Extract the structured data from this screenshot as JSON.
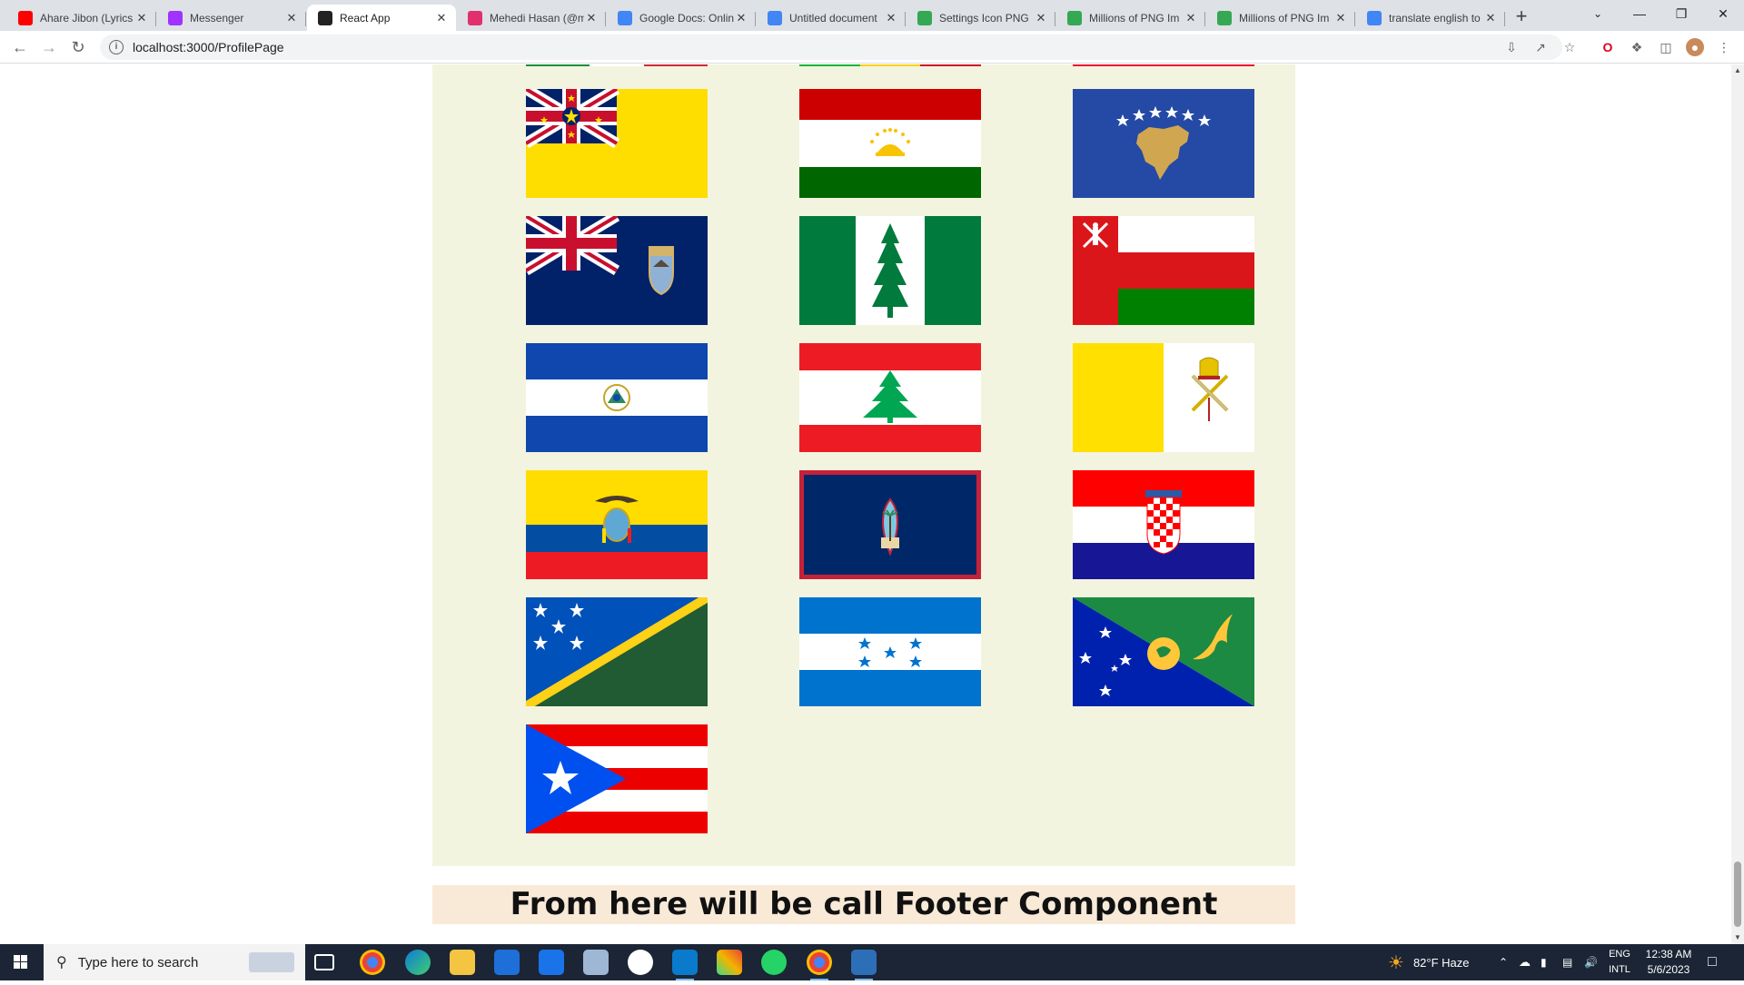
{
  "browser": {
    "tabs": [
      {
        "title": "Ahare Jibon (Lyrics",
        "favicon": "youtube-icon",
        "color": "#ff0000",
        "active": false
      },
      {
        "title": "Messenger",
        "favicon": "messenger-icon",
        "color": "#a033ff",
        "active": false
      },
      {
        "title": "React App",
        "favicon": "react-icon",
        "color": "#222222",
        "active": true
      },
      {
        "title": "Mehedi Hasan (@m",
        "favicon": "instagram-icon",
        "color": "#e1306c",
        "active": false
      },
      {
        "title": "Google Docs: Onlin",
        "favicon": "google-docs-icon",
        "color": "#4285f4",
        "active": false
      },
      {
        "title": "Untitled document",
        "favicon": "google-docs-icon",
        "color": "#4285f4",
        "active": false
      },
      {
        "title": "Settings Icon PNG",
        "favicon": "pngtree-icon",
        "color": "#34a853",
        "active": false
      },
      {
        "title": "Millions of PNG Im",
        "favicon": "pngtree-icon",
        "color": "#34a853",
        "active": false
      },
      {
        "title": "Millions of PNG Im",
        "favicon": "pngtree-icon",
        "color": "#34a853",
        "active": false
      },
      {
        "title": "translate english to",
        "favicon": "google-icon",
        "color": "#4285f4",
        "active": false
      }
    ],
    "url": "localhost:3000/ProfilePage"
  },
  "page": {
    "flags": [
      {
        "country": "Niue"
      },
      {
        "country": "Tajikistan"
      },
      {
        "country": "Kosovo"
      },
      {
        "country": "Saint Helena"
      },
      {
        "country": "Norfolk Island"
      },
      {
        "country": "Oman"
      },
      {
        "country": "El Salvador"
      },
      {
        "country": "Lebanon"
      },
      {
        "country": "Vatican City"
      },
      {
        "country": "Ecuador"
      },
      {
        "country": "Guam"
      },
      {
        "country": "Croatia"
      },
      {
        "country": "Solomon Islands"
      },
      {
        "country": "Honduras"
      },
      {
        "country": "Christmas Island"
      },
      {
        "country": "Puerto Rico"
      }
    ],
    "footer_text": "From here will be call Footer Component"
  },
  "taskbar": {
    "search_placeholder": "Type here to search",
    "weather": "82°F  Haze",
    "lang_line1": "ENG",
    "lang_line2": "INTL",
    "time": "12:38 AM",
    "date": "5/6/2023"
  }
}
